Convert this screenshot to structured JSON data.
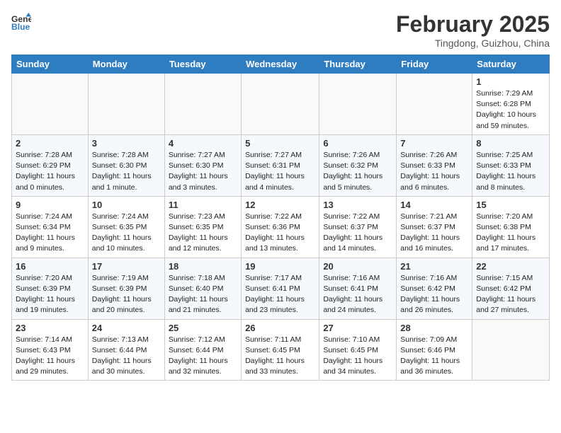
{
  "header": {
    "logo_line1": "General",
    "logo_line2": "Blue",
    "month": "February 2025",
    "location": "Tingdong, Guizhou, China"
  },
  "weekdays": [
    "Sunday",
    "Monday",
    "Tuesday",
    "Wednesday",
    "Thursday",
    "Friday",
    "Saturday"
  ],
  "weeks": [
    [
      {
        "day": "",
        "info": ""
      },
      {
        "day": "",
        "info": ""
      },
      {
        "day": "",
        "info": ""
      },
      {
        "day": "",
        "info": ""
      },
      {
        "day": "",
        "info": ""
      },
      {
        "day": "",
        "info": ""
      },
      {
        "day": "1",
        "info": "Sunrise: 7:29 AM\nSunset: 6:28 PM\nDaylight: 10 hours\nand 59 minutes."
      }
    ],
    [
      {
        "day": "2",
        "info": "Sunrise: 7:28 AM\nSunset: 6:29 PM\nDaylight: 11 hours\nand 0 minutes."
      },
      {
        "day": "3",
        "info": "Sunrise: 7:28 AM\nSunset: 6:30 PM\nDaylight: 11 hours\nand 1 minute."
      },
      {
        "day": "4",
        "info": "Sunrise: 7:27 AM\nSunset: 6:30 PM\nDaylight: 11 hours\nand 3 minutes."
      },
      {
        "day": "5",
        "info": "Sunrise: 7:27 AM\nSunset: 6:31 PM\nDaylight: 11 hours\nand 4 minutes."
      },
      {
        "day": "6",
        "info": "Sunrise: 7:26 AM\nSunset: 6:32 PM\nDaylight: 11 hours\nand 5 minutes."
      },
      {
        "day": "7",
        "info": "Sunrise: 7:26 AM\nSunset: 6:33 PM\nDaylight: 11 hours\nand 6 minutes."
      },
      {
        "day": "8",
        "info": "Sunrise: 7:25 AM\nSunset: 6:33 PM\nDaylight: 11 hours\nand 8 minutes."
      }
    ],
    [
      {
        "day": "9",
        "info": "Sunrise: 7:24 AM\nSunset: 6:34 PM\nDaylight: 11 hours\nand 9 minutes."
      },
      {
        "day": "10",
        "info": "Sunrise: 7:24 AM\nSunset: 6:35 PM\nDaylight: 11 hours\nand 10 minutes."
      },
      {
        "day": "11",
        "info": "Sunrise: 7:23 AM\nSunset: 6:35 PM\nDaylight: 11 hours\nand 12 minutes."
      },
      {
        "day": "12",
        "info": "Sunrise: 7:22 AM\nSunset: 6:36 PM\nDaylight: 11 hours\nand 13 minutes."
      },
      {
        "day": "13",
        "info": "Sunrise: 7:22 AM\nSunset: 6:37 PM\nDaylight: 11 hours\nand 14 minutes."
      },
      {
        "day": "14",
        "info": "Sunrise: 7:21 AM\nSunset: 6:37 PM\nDaylight: 11 hours\nand 16 minutes."
      },
      {
        "day": "15",
        "info": "Sunrise: 7:20 AM\nSunset: 6:38 PM\nDaylight: 11 hours\nand 17 minutes."
      }
    ],
    [
      {
        "day": "16",
        "info": "Sunrise: 7:20 AM\nSunset: 6:39 PM\nDaylight: 11 hours\nand 19 minutes."
      },
      {
        "day": "17",
        "info": "Sunrise: 7:19 AM\nSunset: 6:39 PM\nDaylight: 11 hours\nand 20 minutes."
      },
      {
        "day": "18",
        "info": "Sunrise: 7:18 AM\nSunset: 6:40 PM\nDaylight: 11 hours\nand 21 minutes."
      },
      {
        "day": "19",
        "info": "Sunrise: 7:17 AM\nSunset: 6:41 PM\nDaylight: 11 hours\nand 23 minutes."
      },
      {
        "day": "20",
        "info": "Sunrise: 7:16 AM\nSunset: 6:41 PM\nDaylight: 11 hours\nand 24 minutes."
      },
      {
        "day": "21",
        "info": "Sunrise: 7:16 AM\nSunset: 6:42 PM\nDaylight: 11 hours\nand 26 minutes."
      },
      {
        "day": "22",
        "info": "Sunrise: 7:15 AM\nSunset: 6:42 PM\nDaylight: 11 hours\nand 27 minutes."
      }
    ],
    [
      {
        "day": "23",
        "info": "Sunrise: 7:14 AM\nSunset: 6:43 PM\nDaylight: 11 hours\nand 29 minutes."
      },
      {
        "day": "24",
        "info": "Sunrise: 7:13 AM\nSunset: 6:44 PM\nDaylight: 11 hours\nand 30 minutes."
      },
      {
        "day": "25",
        "info": "Sunrise: 7:12 AM\nSunset: 6:44 PM\nDaylight: 11 hours\nand 32 minutes."
      },
      {
        "day": "26",
        "info": "Sunrise: 7:11 AM\nSunset: 6:45 PM\nDaylight: 11 hours\nand 33 minutes."
      },
      {
        "day": "27",
        "info": "Sunrise: 7:10 AM\nSunset: 6:45 PM\nDaylight: 11 hours\nand 34 minutes."
      },
      {
        "day": "28",
        "info": "Sunrise: 7:09 AM\nSunset: 6:46 PM\nDaylight: 11 hours\nand 36 minutes."
      },
      {
        "day": "",
        "info": ""
      }
    ]
  ]
}
